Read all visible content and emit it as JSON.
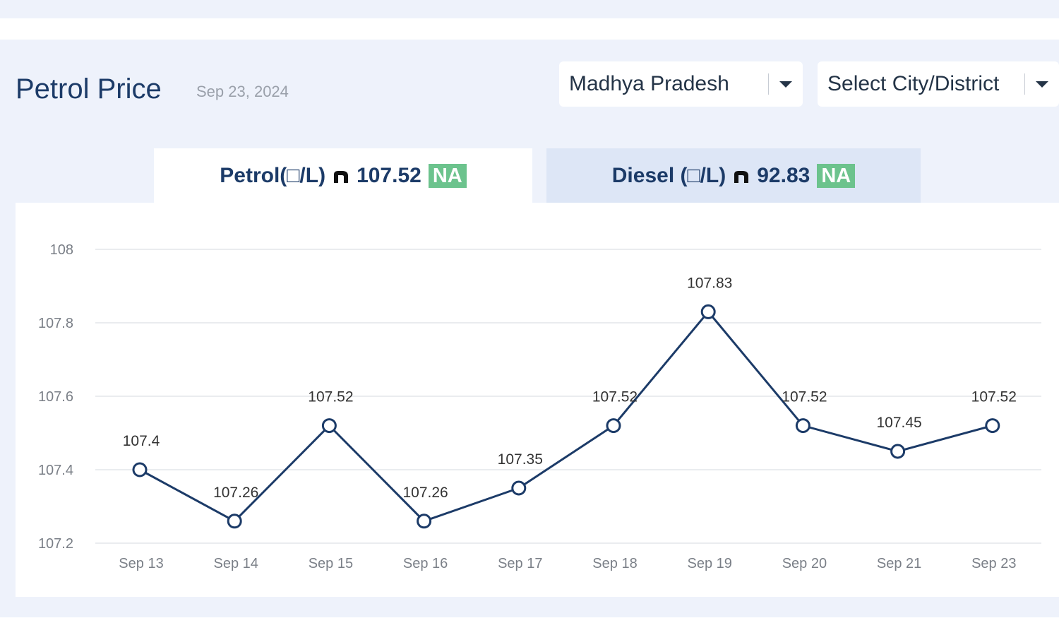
{
  "header": {
    "title": "Petrol Price",
    "date": "Sep 23, 2024",
    "state_select": "Madhya Pradesh",
    "city_select": "Select City/District"
  },
  "tabs": {
    "petrol": {
      "label": "Petrol(□/L)",
      "value": "107.52",
      "badge": "NA"
    },
    "diesel": {
      "label": "Diesel (□/L)",
      "value": "92.83",
      "badge": "NA"
    }
  },
  "colors": {
    "line": "#1c3b68",
    "badge": "#6cc38d",
    "panel": "#eef2fb",
    "tab_inactive": "#dde6f6"
  },
  "chart_data": {
    "type": "line",
    "categories": [
      "Sep 13",
      "Sep 14",
      "Sep 15",
      "Sep 16",
      "Sep 17",
      "Sep 18",
      "Sep 19",
      "Sep 20",
      "Sep 21",
      "Sep 23"
    ],
    "series": [
      {
        "values": [
          107.4,
          107.26,
          107.52,
          107.26,
          107.35,
          107.52,
          107.83,
          107.52,
          107.45,
          107.52
        ]
      }
    ],
    "data_labels": [
      "107.4",
      "107.26",
      "107.52",
      "107.26",
      "107.35",
      "107.52",
      "107.83",
      "107.52",
      "107.45",
      "107.52"
    ],
    "yticks": [
      "107.2",
      "107.4",
      "107.6",
      "107.8",
      "108"
    ],
    "ylim": [
      107.2,
      108
    ],
    "grid": true
  }
}
